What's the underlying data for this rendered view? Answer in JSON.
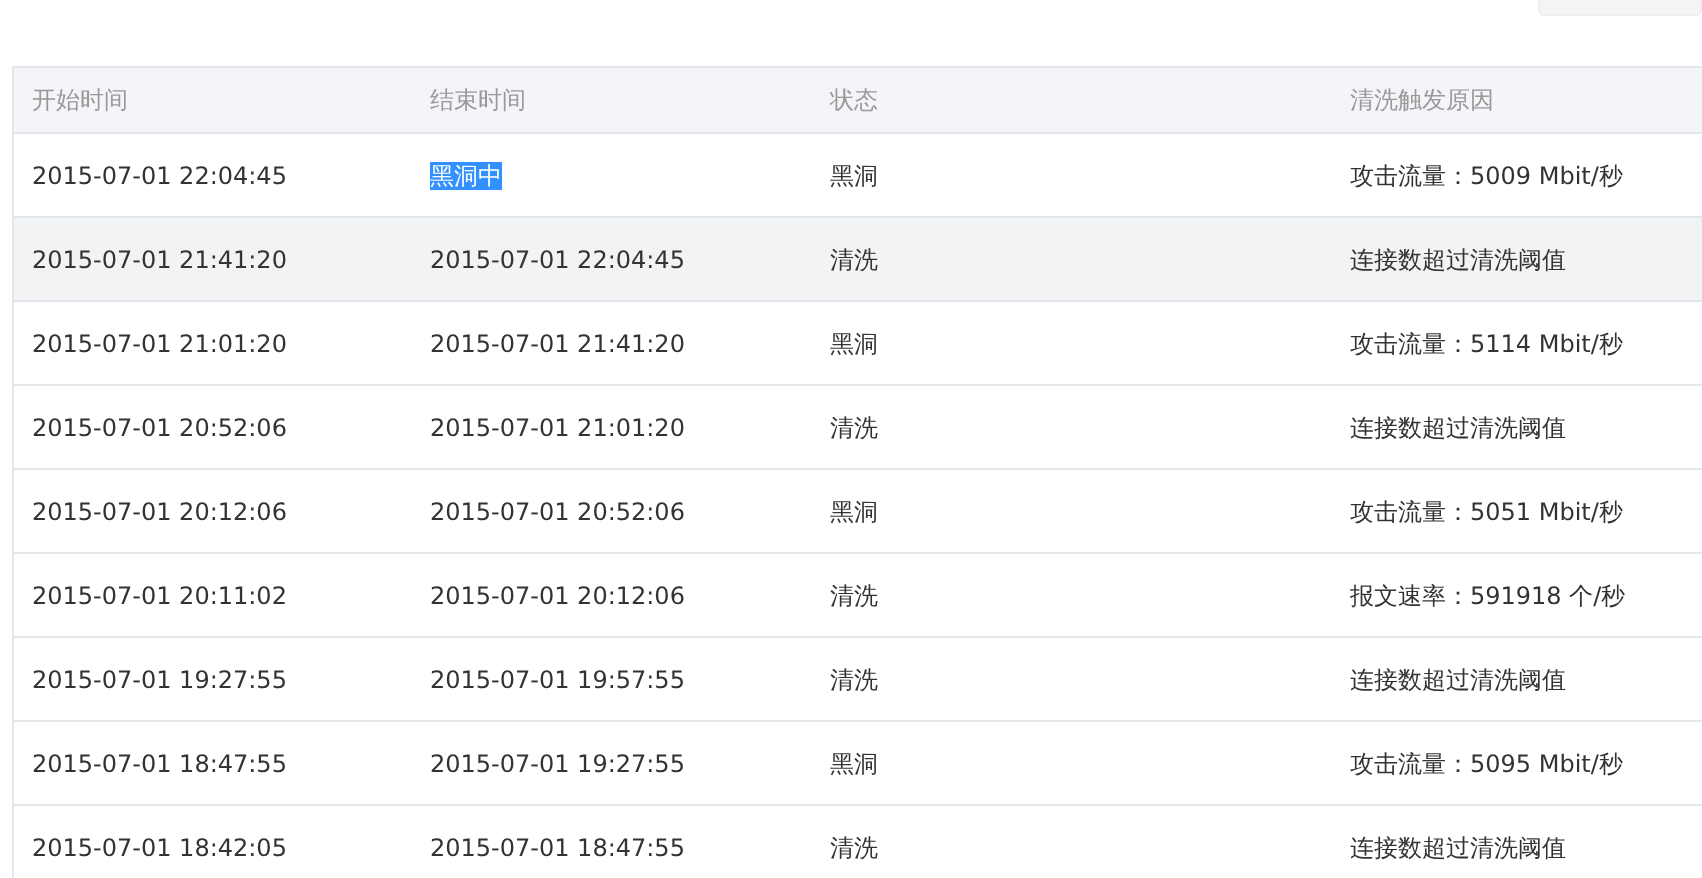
{
  "toolbar_button": {
    "visible": true
  },
  "table": {
    "columns": [
      "开始时间",
      "结束时间",
      "状态",
      "清洗触发原因"
    ],
    "rows": [
      {
        "cells": [
          "2015-07-01 22:04:45",
          "黑洞中",
          "黑洞",
          "攻击流量：5009 Mbit/秒"
        ],
        "hovered": false,
        "text_selected": true
      },
      {
        "cells": [
          "2015-07-01 21:41:20",
          "2015-07-01 22:04:45",
          "清洗",
          "连接数超过清洗阈值"
        ],
        "hovered": true,
        "text_selected": false
      },
      {
        "cells": [
          "2015-07-01 21:01:20",
          "2015-07-01 21:41:20",
          "黑洞",
          "攻击流量：5114 Mbit/秒"
        ],
        "hovered": false,
        "text_selected": false
      },
      {
        "cells": [
          "2015-07-01 20:52:06",
          "2015-07-01 21:01:20",
          "清洗",
          "连接数超过清洗阈值"
        ],
        "hovered": false,
        "text_selected": false
      },
      {
        "cells": [
          "2015-07-01 20:12:06",
          "2015-07-01 20:52:06",
          "黑洞",
          "攻击流量：5051 Mbit/秒"
        ],
        "hovered": false,
        "text_selected": false
      },
      {
        "cells": [
          "2015-07-01 20:11:02",
          "2015-07-01 20:12:06",
          "清洗",
          "报文速率：591918 个/秒"
        ],
        "hovered": false,
        "text_selected": false
      },
      {
        "cells": [
          "2015-07-01 19:27:55",
          "2015-07-01 19:57:55",
          "清洗",
          "连接数超过清洗阈值"
        ],
        "hovered": false,
        "text_selected": false
      },
      {
        "cells": [
          "2015-07-01 18:47:55",
          "2015-07-01 19:27:55",
          "黑洞",
          "攻击流量：5095 Mbit/秒"
        ],
        "hovered": false,
        "text_selected": false
      },
      {
        "cells": [
          "2015-07-01 18:42:05",
          "2015-07-01 18:47:55",
          "清洗",
          "连接数超过清洗阈值"
        ],
        "hovered": false,
        "text_selected": false
      }
    ]
  }
}
